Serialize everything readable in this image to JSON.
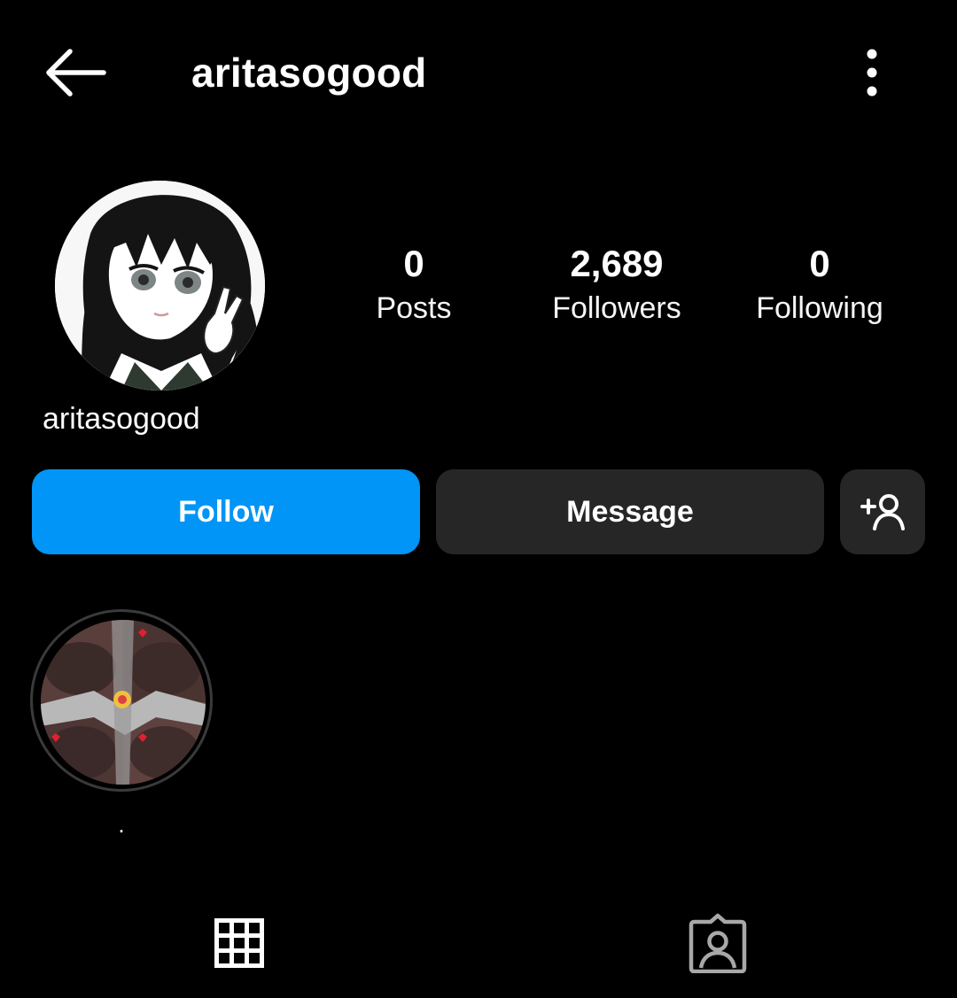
{
  "header": {
    "title": "aritasogood",
    "back_icon": "arrow-left-icon",
    "more_icon": "more-vertical-icon"
  },
  "profile": {
    "username": "aritasogood",
    "avatar": "profile-avatar",
    "stats": {
      "posts": {
        "value": "0",
        "label": "Posts"
      },
      "followers": {
        "value": "2,689",
        "label": "Followers"
      },
      "following": {
        "value": "0",
        "label": "Following"
      }
    }
  },
  "actions": {
    "follow_label": "Follow",
    "message_label": "Message",
    "add_user_icon": "add-person-icon"
  },
  "highlights": [
    {
      "label": "."
    }
  ],
  "tabs": [
    {
      "icon": "grid-icon"
    },
    {
      "icon": "tagged-person-icon"
    }
  ],
  "colors": {
    "background": "#000000",
    "accent": "#0095f6",
    "secondary_button": "#262626",
    "text": "#ffffff"
  }
}
